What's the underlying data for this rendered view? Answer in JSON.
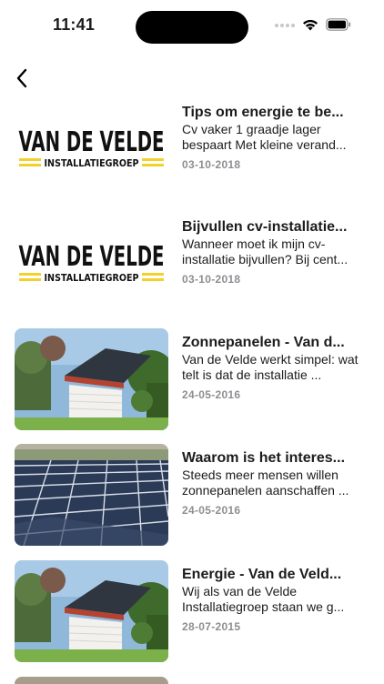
{
  "status_bar": {
    "time": "11:41",
    "icons": [
      "signal-icon",
      "wifi-icon",
      "battery-icon"
    ]
  },
  "nav": {
    "back_icon": "chevron-left-icon"
  },
  "logo": {
    "line1": "VAN DE VELDE",
    "line2": "INSTALLATIEGROEP",
    "accent": "#F2D12B"
  },
  "articles": [
    {
      "title": "Tips om energie te be...",
      "summary": "Cv vaker 1 graadje lager bespaart Met kleine verand...",
      "date": "03-10-2018",
      "image": "logo"
    },
    {
      "title": "Bijvullen cv-installatie...",
      "summary": "Wanneer moet ik mijn cv-installatie bijvullen? Bij cent...",
      "date": "03-10-2018",
      "image": "logo"
    },
    {
      "title": "Zonnepanelen - Van d...",
      "summary": "Van de Velde werkt simpel: wat telt is dat de installatie ...",
      "date": "24-05-2016",
      "image": "house-solar-photo"
    },
    {
      "title": "Waarom is het interes...",
      "summary": "Steeds meer mensen willen zonnepanelen aanschaffen ...",
      "date": "24-05-2016",
      "image": "solar-field-photo"
    },
    {
      "title": "Energie - Van de Veld...",
      "summary": "Wij als van de Velde Installatiegroep staan we g...",
      "date": "28-07-2015",
      "image": "house-solar-photo"
    }
  ]
}
